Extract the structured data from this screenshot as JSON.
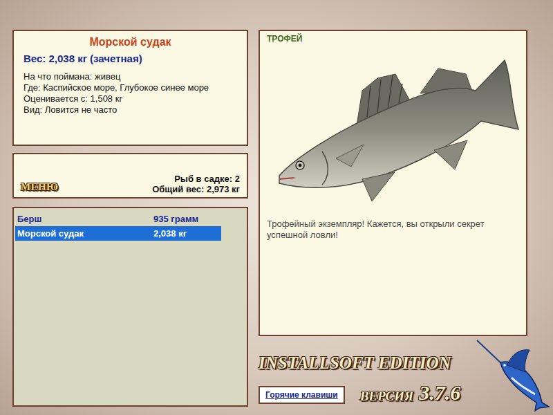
{
  "fish_info": {
    "name": "Морской судак",
    "weight": "Вес: 2,038 кг (зачетная)",
    "details": [
      "На что поймана: живец",
      "Где: Каспийское море, Глубокое синее море",
      "Оценивается с: 1,508 кг",
      "Вид: Ловится не часто"
    ]
  },
  "menu_button": "МЕНЮ",
  "keepnet": {
    "count": "Рыб в садке: 2",
    "total": "Общий вес: 2,973 кг"
  },
  "catch_list": [
    {
      "name": "Берш",
      "weight": "935 грамм",
      "selected": false
    },
    {
      "name": "Морской судак",
      "weight": "2,038 кг",
      "selected": true
    }
  ],
  "trophy": {
    "badge": "ТРОФЕЙ",
    "message": "Трофейный экземпляр! Кажется, вы открыли секрет успешной ловли!"
  },
  "edition": "INSTALLSOFT EDITION",
  "version_label": "ВЕРСИЯ",
  "version": "3.7.6",
  "hotkeys_button": "Горячие клавиши"
}
